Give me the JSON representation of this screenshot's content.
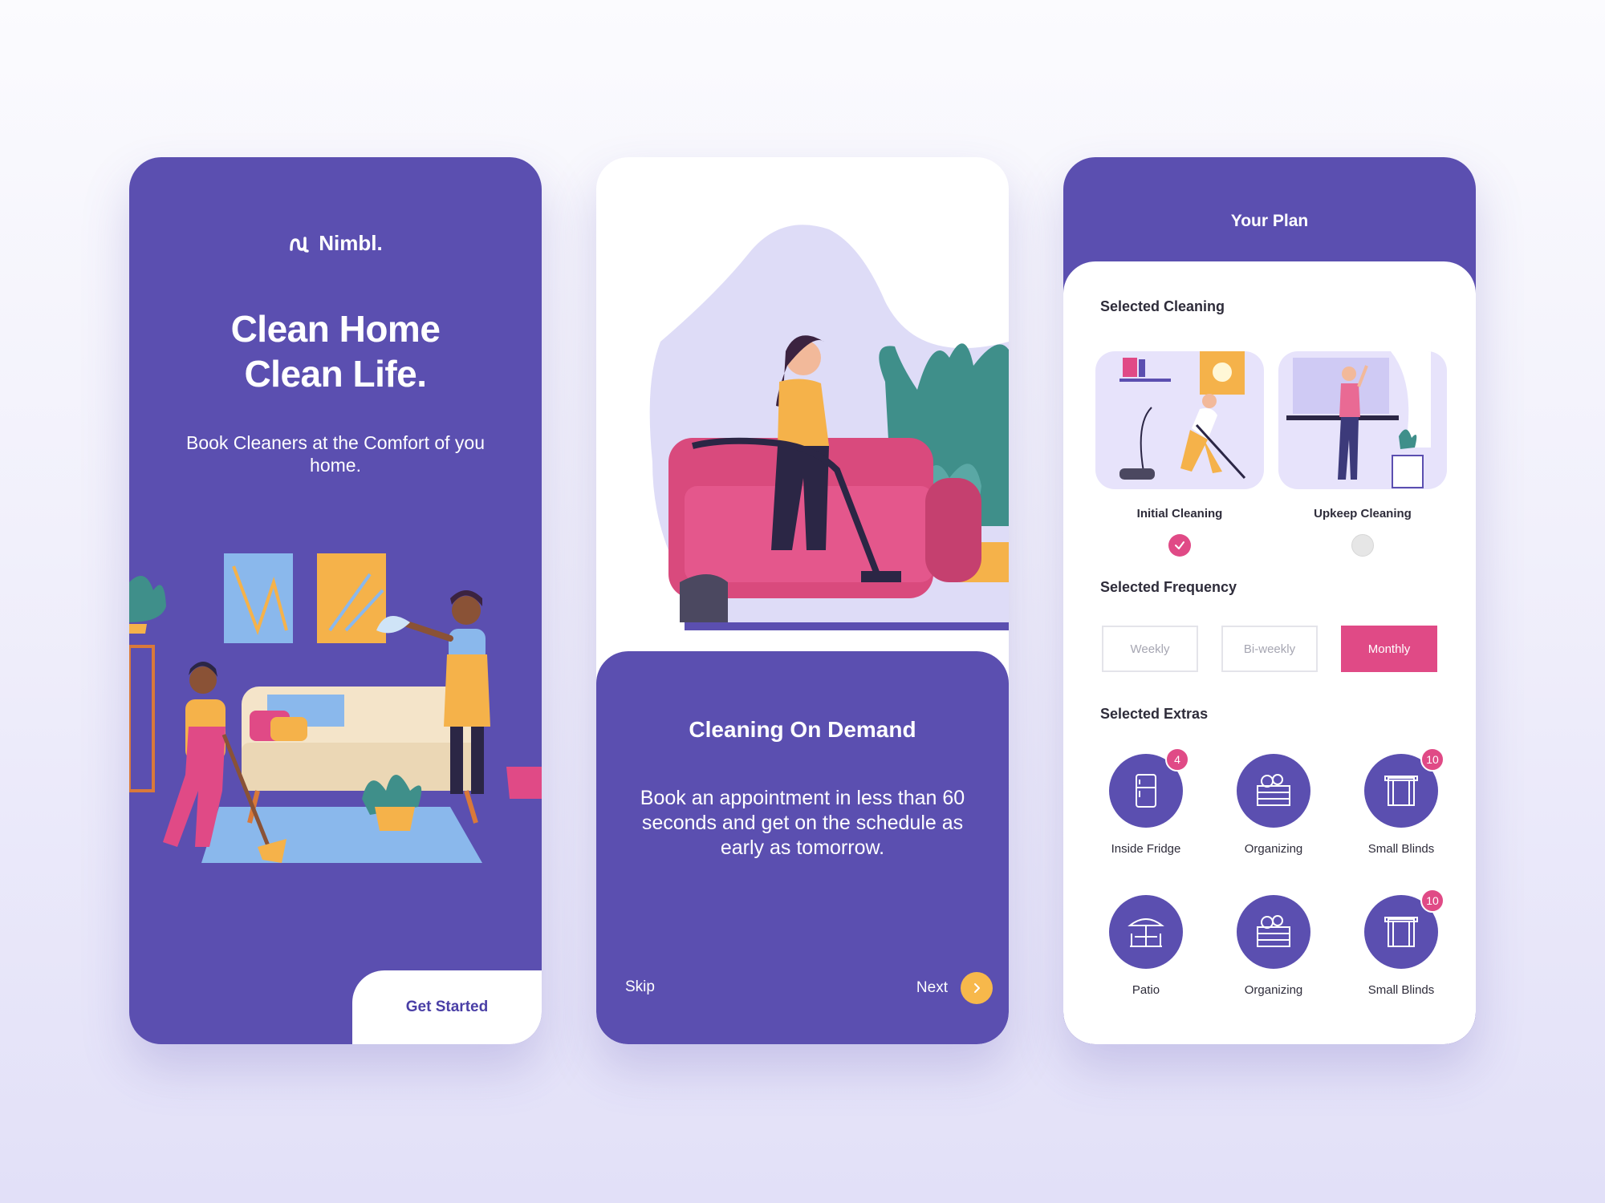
{
  "colors": {
    "primary": "#5b4fb0",
    "accent_pink": "#e04a86",
    "accent_yellow": "#f7b84b",
    "background": "#f1f0fb"
  },
  "onboarding": {
    "brand": "Nimbl.",
    "title_line1": "Clean Home",
    "title_line2": "Clean Life.",
    "subtitle": "Book Cleaners at the Comfort of you home.",
    "cta": "Get Started"
  },
  "intro": {
    "title": "Cleaning On Demand",
    "body": "Book an appointment in less than 60 seconds and get on the schedule as early as tomorrow.",
    "skip": "Skip",
    "next": "Next"
  },
  "plan": {
    "title": "Your Plan",
    "cleaning_label": "Selected Cleaning",
    "cleaning_options": [
      {
        "label": "Initial Cleaning",
        "selected": true
      },
      {
        "label": "Upkeep Cleaning",
        "selected": false
      }
    ],
    "frequency_label": "Selected Frequency",
    "frequency_options": [
      "Weekly",
      "Bi-weekly",
      "Monthly"
    ],
    "frequency_selected": "Monthly",
    "extras_label": "Selected Extras",
    "extras": [
      {
        "label": "Inside Fridge",
        "icon": "fridge-icon",
        "badge": "4"
      },
      {
        "label": "Organizing",
        "icon": "crate-icon",
        "badge": ""
      },
      {
        "label": "Small Blinds",
        "icon": "window-icon",
        "badge": "10"
      },
      {
        "label": "Patio",
        "icon": "patio-icon",
        "badge": ""
      },
      {
        "label": "Organizing",
        "icon": "crate-icon",
        "badge": ""
      },
      {
        "label": "Small Blinds",
        "icon": "window-icon",
        "badge": "10"
      }
    ]
  }
}
